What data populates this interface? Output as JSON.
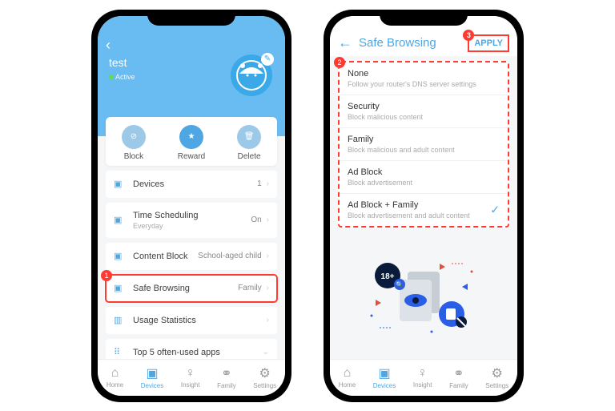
{
  "left": {
    "profile_name": "test",
    "status": "Active",
    "actions": {
      "block": "Block",
      "reward": "Reward",
      "delete": "Delete"
    },
    "rows": {
      "devices": {
        "label": "Devices",
        "value": "1"
      },
      "time": {
        "label": "Time Scheduling",
        "sub": "Everyday",
        "value": "On"
      },
      "content": {
        "label": "Content Block",
        "value": "School-aged child"
      },
      "safe": {
        "label": "Safe Browsing",
        "value": "Family"
      },
      "usage": {
        "label": "Usage Statistics"
      },
      "top5": {
        "label": "Top 5 often-used apps"
      }
    },
    "badge1": "1"
  },
  "right": {
    "title": "Safe Browsing",
    "apply": "APPLY",
    "badge2": "2",
    "badge3": "3",
    "options": [
      {
        "title": "None",
        "desc": "Follow your router's DNS server settings"
      },
      {
        "title": "Security",
        "desc": "Block malicious content"
      },
      {
        "title": "Family",
        "desc": "Block malicious and adult content"
      },
      {
        "title": "Ad Block",
        "desc": "Block advertisement"
      },
      {
        "title": "Ad Block + Family",
        "desc": "Block advertisement and adult content"
      }
    ],
    "selected_index": 4
  },
  "tabs": {
    "home": "Home",
    "devices": "Devices",
    "insight": "Insight",
    "family": "Family",
    "settings": "Settings"
  }
}
